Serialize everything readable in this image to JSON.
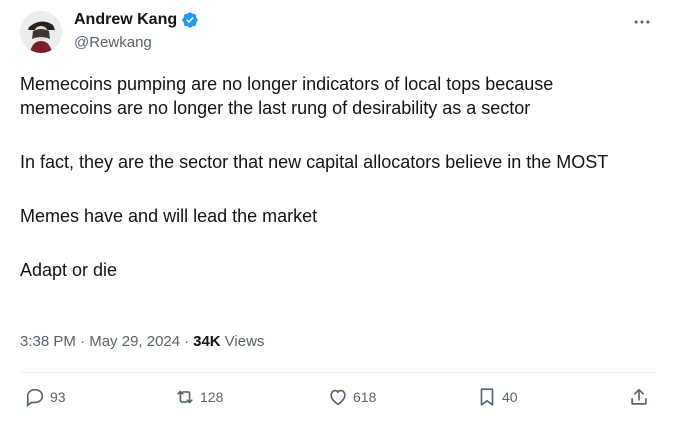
{
  "author": {
    "display_name": "Andrew Kang",
    "handle": "@Rewkang",
    "verified": true,
    "avatar_icon": "profile-avatar"
  },
  "more_icon": "more-horizontal-icon",
  "tweet": {
    "paragraphs": [
      "Memecoins pumping are no longer indicators of local tops because memecoins are no longer the last rung of desirability as a sector",
      "In fact, they are the sector that new capital allocators believe in the MOST",
      "Memes have and will lead the market",
      "Adapt or die"
    ]
  },
  "meta": {
    "time": "3:38 PM",
    "separator": "·",
    "date": "May 29, 2024",
    "views_count": "34K",
    "views_label": "Views"
  },
  "actions": {
    "replies": "93",
    "reposts": "128",
    "likes": "618",
    "bookmarks": "40"
  },
  "colors": {
    "text": "#0f1419",
    "secondary": "#536471",
    "verified": "#1d9bf0",
    "divider": "#eff3f4"
  }
}
